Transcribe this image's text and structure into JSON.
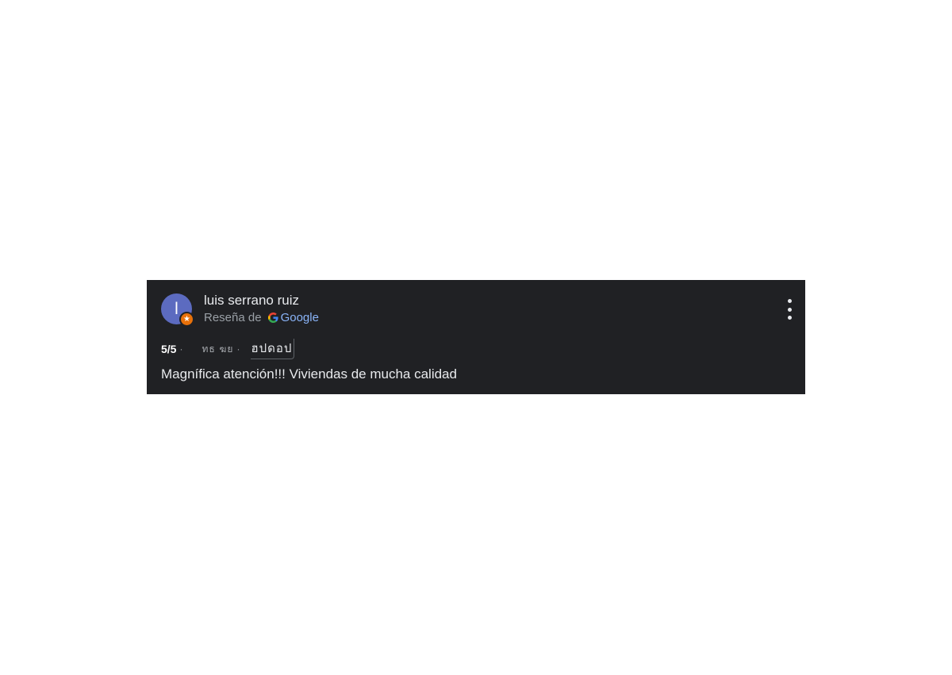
{
  "review": {
    "avatar_initial": "l",
    "reviewer_name": "luis serrano ruiz",
    "source_prefix": "Reseña de",
    "source_name": "Google",
    "rating": "5/5",
    "separator": "·",
    "date_text": "ทธ ฆย",
    "date_text_2": "ฮปดอป",
    "body": "Magnífica atención!!! Viviendas de mucha calidad"
  },
  "colors": {
    "card_background": "#202124",
    "avatar": "#5c6bc0",
    "badge": "#e8710a",
    "google_link": "#8ab4f8"
  },
  "icons": {
    "badge": "local-guide-star-icon",
    "google": "google-g-icon",
    "menu": "more-vert-icon"
  }
}
